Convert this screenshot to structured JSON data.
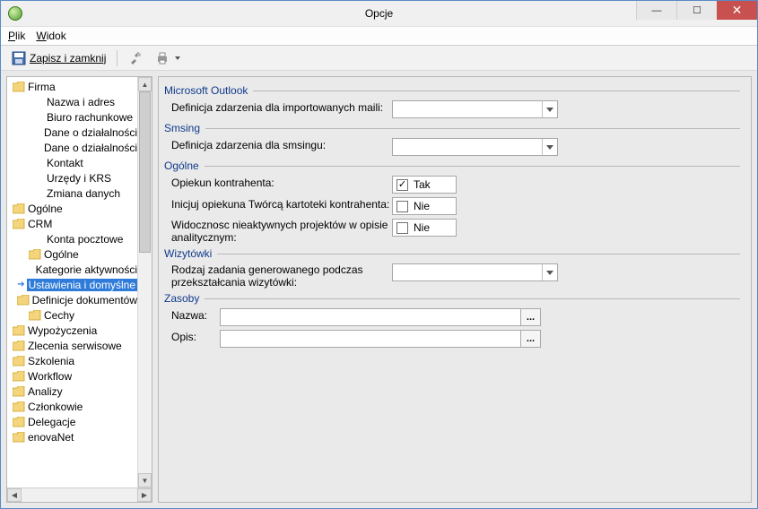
{
  "window": {
    "title": "Opcje"
  },
  "winbuttons": {
    "min": "—",
    "max": "☐",
    "close": "✕"
  },
  "menu": {
    "plik": "Plik",
    "widok": "Widok"
  },
  "toolbar": {
    "save_label": "Zapisz i zamknij"
  },
  "tree": {
    "items": [
      {
        "indent": 0,
        "folder": true,
        "label": "Firma"
      },
      {
        "indent": 1,
        "folder": false,
        "label": "Nazwa i adres"
      },
      {
        "indent": 1,
        "folder": false,
        "label": "Biuro rachunkowe"
      },
      {
        "indent": 1,
        "folder": false,
        "label": "Dane o działalności"
      },
      {
        "indent": 1,
        "folder": false,
        "label": "Dane o działalności"
      },
      {
        "indent": 1,
        "folder": false,
        "label": "Kontakt"
      },
      {
        "indent": 1,
        "folder": false,
        "label": "Urzędy i KRS"
      },
      {
        "indent": 1,
        "folder": false,
        "label": "Zmiana danych"
      },
      {
        "indent": 0,
        "folder": true,
        "label": "Ogólne"
      },
      {
        "indent": 0,
        "folder": true,
        "label": "CRM"
      },
      {
        "indent": 1,
        "folder": false,
        "label": "Konta pocztowe"
      },
      {
        "indent": 1,
        "folder": true,
        "label": "Ogólne"
      },
      {
        "indent": 2,
        "folder": false,
        "label": "Kategorie aktywności"
      },
      {
        "indent": 2,
        "folder": false,
        "label": "Ustawienia i domyślne",
        "selected": true
      },
      {
        "indent": 1,
        "folder": true,
        "label": "Definicje dokumentów"
      },
      {
        "indent": 1,
        "folder": true,
        "label": "Cechy"
      },
      {
        "indent": 0,
        "folder": true,
        "label": "Wypożyczenia"
      },
      {
        "indent": 0,
        "folder": true,
        "label": "Zlecenia serwisowe"
      },
      {
        "indent": 0,
        "folder": true,
        "label": "Szkolenia"
      },
      {
        "indent": 0,
        "folder": true,
        "label": "Workflow"
      },
      {
        "indent": 0,
        "folder": true,
        "label": "Analizy"
      },
      {
        "indent": 0,
        "folder": true,
        "label": "Członkowie"
      },
      {
        "indent": 0,
        "folder": true,
        "label": "Delegacje"
      },
      {
        "indent": 0,
        "folder": true,
        "label": "enovaNet"
      }
    ]
  },
  "form": {
    "groups": {
      "outlook": {
        "title": "Microsoft Outlook",
        "field1_label": "Definicja zdarzenia dla importowanych maili:"
      },
      "smsing": {
        "title": "Smsing",
        "field1_label": "Definicja zdarzenia dla smsingu:"
      },
      "ogolne": {
        "title": "Ogólne",
        "field1_label": "Opiekun kontrahenta:",
        "field1_value": "Tak",
        "field1_checked": true,
        "field2_label": "Inicjuj opiekuna Twórcą kartoteki kontrahenta:",
        "field2_value": "Nie",
        "field2_checked": false,
        "field3_label": "Widocznosc nieaktywnych projektów w opisie analitycznym:",
        "field3_value": "Nie",
        "field3_checked": false
      },
      "wizytowki": {
        "title": "Wizytówki",
        "field1_label": "Rodzaj zadania generowanego podczas przekształcania wizytówki:"
      },
      "zasoby": {
        "title": "Zasoby",
        "field1_label": "Nazwa:",
        "field2_label": "Opis:",
        "ellipsis": "..."
      }
    }
  }
}
